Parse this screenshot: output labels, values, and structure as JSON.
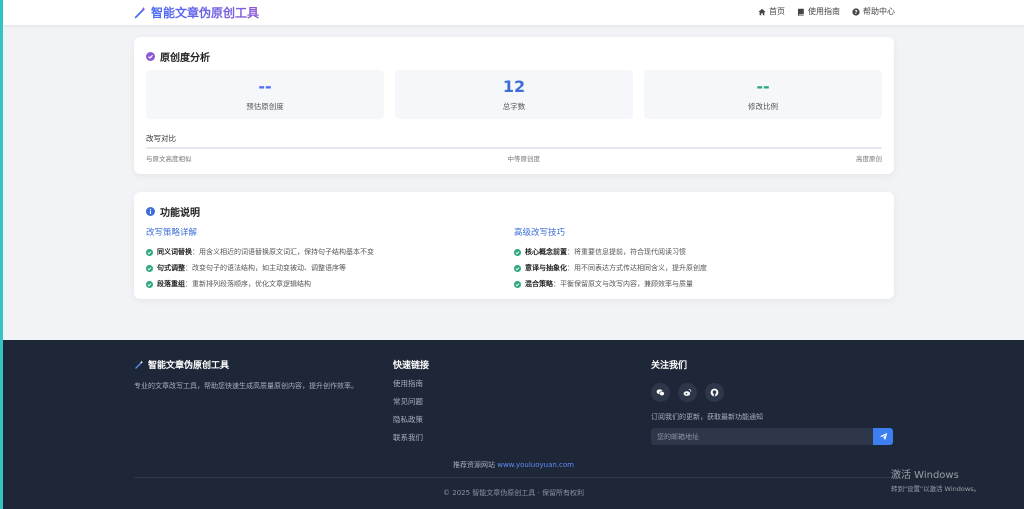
{
  "colors": {
    "accent": "#4a6cf7",
    "brand_gradient_end": "#8e58d6",
    "success": "#2aa87a",
    "footer_bg": "#1e2738",
    "left_strip": "#35c4c4"
  },
  "header": {
    "title": "智能文章伪原创工具",
    "logo_icon": "magic-wand-icon",
    "nav": [
      {
        "label": "首页",
        "icon": "home-icon"
      },
      {
        "label": "使用指南",
        "icon": "book-icon"
      },
      {
        "label": "帮助中心",
        "icon": "question-circle-icon"
      }
    ]
  },
  "analysis": {
    "title": "原创度分析",
    "stats": [
      {
        "value": "--",
        "label": "预估原创度",
        "color": "#4a6cf7"
      },
      {
        "value": "12",
        "label": "总字数",
        "color": "#3d6ed8"
      },
      {
        "value": "--",
        "label": "修改比例",
        "color": "#2aa87a"
      }
    ],
    "compare_title": "改写对比",
    "compare_labels": [
      "与原文高度相似",
      "中等原创度",
      "高度原创"
    ]
  },
  "features": {
    "title": "功能说明",
    "columns": [
      {
        "heading": "改写策略详解",
        "items": [
          {
            "term": "同义词替换",
            "desc": "：用含义相近的词语替换原文词汇，保持句子结构基本不变"
          },
          {
            "term": "句式调整",
            "desc": "：改变句子的语法结构，如主动变被动、调整语序等"
          },
          {
            "term": "段落重组",
            "desc": "：重新排列段落顺序，优化文章逻辑结构"
          }
        ]
      },
      {
        "heading": "高级改写技巧",
        "items": [
          {
            "term": "核心概念前置",
            "desc": "：将重要信息提前，符合现代阅读习惯"
          },
          {
            "term": "意译与抽象化",
            "desc": "：用不同表达方式传达相同含义，提升原创度"
          },
          {
            "term": "混合策略",
            "desc": "：平衡保留原文与改写内容，兼顾效率与质量"
          }
        ]
      }
    ]
  },
  "footer": {
    "brand": "智能文章伪原创工具",
    "desc": "专业的文章改写工具，帮助您快速生成高质量原创内容，提升创作效率。",
    "links_heading": "快速链接",
    "links": [
      "使用指南",
      "常见问题",
      "隐私政策",
      "联系我们"
    ],
    "follow_heading": "关注我们",
    "social": [
      "wechat-icon",
      "weibo-icon",
      "github-icon"
    ],
    "subscribe_text": "订阅我们的更新，获取最新功能通知",
    "email_placeholder": "您的邮箱地址",
    "friend_label": "推荐资源网站",
    "friend_link": "www.youluoyuan.com",
    "copyright": "© 2025 智能文章伪原创工具 · 保留所有权利"
  },
  "watermark": {
    "title": "激活 Windows",
    "sub": "转到\"设置\"以激活 Windows。"
  }
}
